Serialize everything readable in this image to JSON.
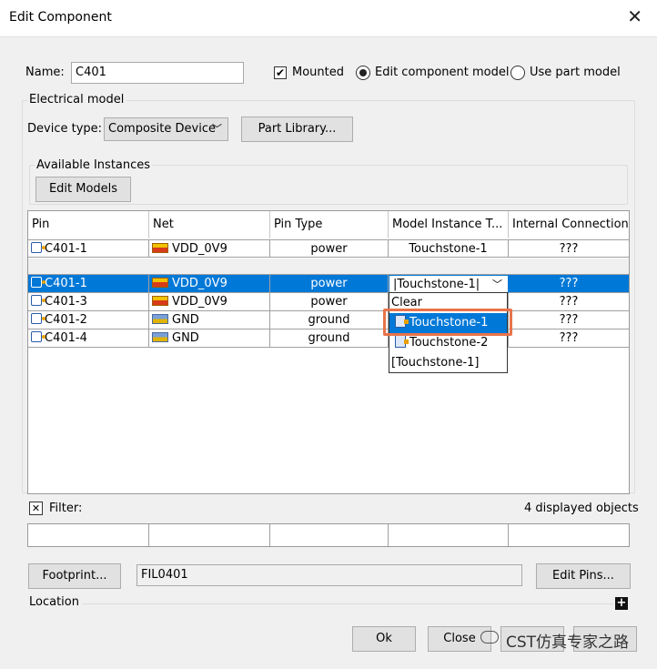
{
  "window": {
    "title": "Edit Component",
    "close_glyph": "✕"
  },
  "name_field": {
    "label": "Name:",
    "value": "C401"
  },
  "mounted": {
    "label": "Mounted",
    "checked": true
  },
  "model_choice": {
    "edit_label": "Edit component model",
    "use_label": "Use part model",
    "selected": "edit"
  },
  "electrical": {
    "group_label": "Electrical model",
    "device_type_label": "Device type:",
    "device_type_value": "Composite Device",
    "part_library_button": "Part Library..."
  },
  "instances": {
    "group_label": "Available Instances",
    "edit_models_button": "Edit Models"
  },
  "table_headers": [
    "Pin",
    "Net",
    "Pin Type",
    "Model Instance T...",
    "Internal Connection"
  ],
  "top_row": {
    "pin": "C401-1",
    "net": "VDD_0V9",
    "type": "power",
    "model": "Touchstone-1",
    "conn": "???"
  },
  "rows": [
    {
      "pin": "C401-1",
      "net": "VDD_0V9",
      "type": "power",
      "model": "|Touchstone-1|",
      "conn": "???"
    },
    {
      "pin": "C401-3",
      "net": "VDD_0V9",
      "type": "power",
      "model": "",
      "conn": "???"
    },
    {
      "pin": "C401-2",
      "net": "GND",
      "type": "ground",
      "model": "",
      "conn": "???"
    },
    {
      "pin": "C401-4",
      "net": "GND",
      "type": "ground",
      "model": "",
      "conn": "???"
    }
  ],
  "dropdown": {
    "items": [
      "Clear",
      "Touchstone-1",
      "Touchstone-2",
      "[Touchstone-1]"
    ],
    "highlighted": "Touchstone-1"
  },
  "filter": {
    "clear_glyph": "✕",
    "label": "Filter:",
    "count_text": "4 displayed objects"
  },
  "footprint": {
    "button": "Footprint...",
    "value": "FIL0401",
    "edit_pins_button": "Edit Pins..."
  },
  "location": {
    "label": "Location",
    "expand_glyph": "+"
  },
  "bottom_buttons": {
    "ok": "Ok",
    "close": "Close"
  },
  "watermark": "CST仿真专家之路",
  "colors": {
    "selection": "#0078d7",
    "highlight_box": "#e8734a"
  }
}
